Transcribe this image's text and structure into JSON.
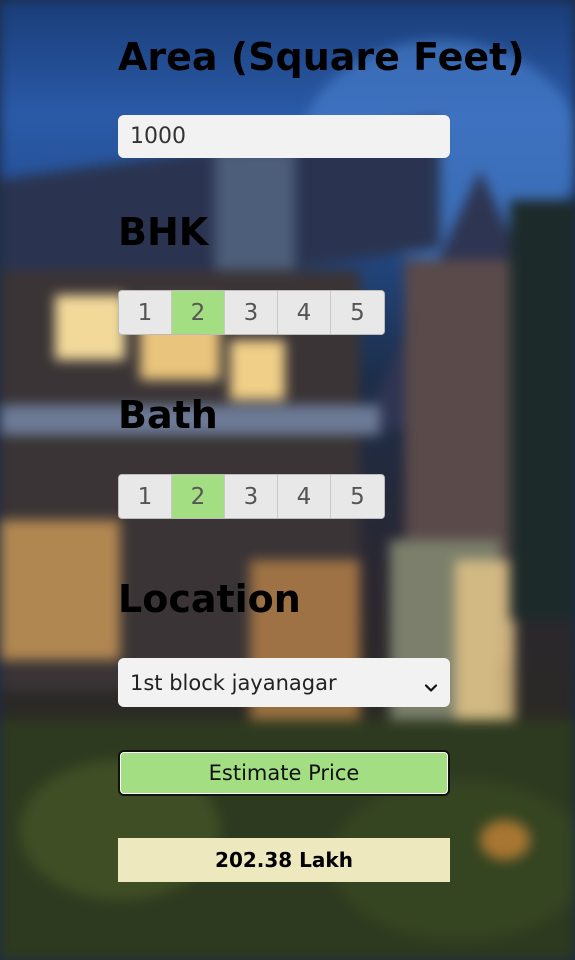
{
  "area": {
    "heading": "Area (Square Feet)",
    "value": "1000"
  },
  "bhk": {
    "heading": "BHK",
    "options": [
      "1",
      "2",
      "3",
      "4",
      "5"
    ],
    "selected": "2"
  },
  "bath": {
    "heading": "Bath",
    "options": [
      "1",
      "2",
      "3",
      "4",
      "5"
    ],
    "selected": "2"
  },
  "location": {
    "heading": "Location",
    "selected": "1st block jayanagar"
  },
  "estimate_button": {
    "label": "Estimate Price"
  },
  "result": {
    "text": "202.38 Lakh"
  },
  "colors": {
    "accent_green": "#a3de83",
    "result_background": "#ede8bd",
    "input_background": "#f2f2f2"
  },
  "icons": {
    "select_arrow": "chevron-down-icon"
  }
}
